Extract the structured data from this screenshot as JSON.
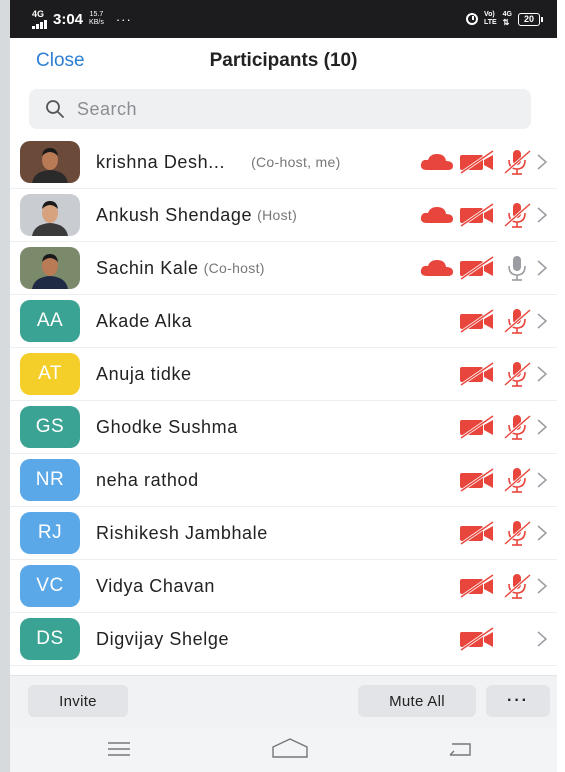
{
  "status_bar": {
    "network": "4G",
    "time": "3:04",
    "speed_value": "15.7",
    "speed_unit": "KB/s",
    "dots": "···",
    "volte_top": "Vo)",
    "volte_bottom": "LTE",
    "net_right": "4G",
    "battery": "20"
  },
  "header": {
    "close_label": "Close",
    "title": "Participants (10)"
  },
  "search": {
    "placeholder": "Search",
    "value": ""
  },
  "participants": [
    {
      "name": "krishna Desh...",
      "role": "(Co-host, me)",
      "avatar_type": "photo",
      "photo_bg": "#6b4a3a",
      "cloud": true,
      "video_off": true,
      "mic": "muted"
    },
    {
      "name": "Ankush Shendage",
      "role": "(Host)",
      "avatar_type": "photo",
      "photo_bg": "#c9cdd2",
      "cloud": true,
      "video_off": true,
      "mic": "muted"
    },
    {
      "name": "Sachin Kale",
      "role": "(Co-host)",
      "avatar_type": "photo",
      "photo_bg": "#7a8a6a",
      "cloud": true,
      "video_off": true,
      "mic": "on"
    },
    {
      "name": "Akade Alka",
      "role": "",
      "initials": "AA",
      "avatar_color": "#3aa393",
      "cloud": false,
      "video_off": true,
      "mic": "muted"
    },
    {
      "name": "Anuja tidke",
      "role": "",
      "initials": "AT",
      "avatar_color": "#f4cf2a",
      "cloud": false,
      "video_off": true,
      "mic": "muted"
    },
    {
      "name": "Ghodke Sushma",
      "role": "",
      "initials": "GS",
      "avatar_color": "#3aa393",
      "cloud": false,
      "video_off": true,
      "mic": "muted"
    },
    {
      "name": "neha rathod",
      "role": "",
      "initials": "NR",
      "avatar_color": "#5aa8e8",
      "cloud": false,
      "video_off": true,
      "mic": "muted"
    },
    {
      "name": "Rishikesh Jambhale",
      "role": "",
      "initials": "RJ",
      "avatar_color": "#5aa8e8",
      "cloud": false,
      "video_off": true,
      "mic": "muted"
    },
    {
      "name": "Vidya Chavan",
      "role": "",
      "initials": "VC",
      "avatar_color": "#5aa8e8",
      "cloud": false,
      "video_off": true,
      "mic": "muted"
    },
    {
      "name": "Digvijay Shelge",
      "role": "",
      "initials": "DS",
      "avatar_color": "#3aa393",
      "cloud": false,
      "video_off": true,
      "mic": "none"
    }
  ],
  "bottom": {
    "invite_label": "Invite",
    "mute_all_label": "Mute All",
    "more_label": "···"
  },
  "colors": {
    "accent": "#2d7fd3",
    "muted_red": "#e8453c",
    "mic_gray": "#9a9da2"
  },
  "icons": [
    "search-icon",
    "cloud-record-icon",
    "video-off-icon",
    "mic-muted-icon",
    "mic-icon",
    "chevron-right-icon",
    "menu-icon",
    "home-icon",
    "back-icon"
  ]
}
